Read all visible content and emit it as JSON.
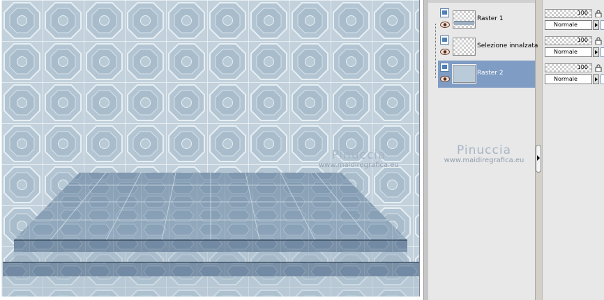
{
  "canvas": {
    "watermark": {
      "title": "Pinuccia",
      "url": "www.maidiregrafica.eu"
    },
    "colors": {
      "pattern_base": "#c3d1dc",
      "pattern_line": "#eef5f7",
      "pattern_dark": "#a9bccb",
      "step_dark": "#5f7590"
    }
  },
  "layers": {
    "items": [
      {
        "name": "Raster 1",
        "selected": false
      },
      {
        "name": "Selezione innalzata",
        "selected": false
      },
      {
        "name": "Raster 2",
        "selected": true
      }
    ],
    "watermark": {
      "title": "Pinuccia",
      "url": "www.maidiregrafica.eu"
    },
    "selected_color": "#7f9cc4"
  },
  "properties": {
    "rows": [
      {
        "opacity": "100",
        "blend_mode": "Normale"
      },
      {
        "opacity": "100",
        "blend_mode": "Normale"
      },
      {
        "opacity": "100",
        "blend_mode": "Normale"
      }
    ]
  },
  "icons": {
    "visibility": "eye-icon",
    "layer_type": "raster-layer-icon",
    "lock": "lock-icon",
    "expand": "chevron-right-icon"
  }
}
